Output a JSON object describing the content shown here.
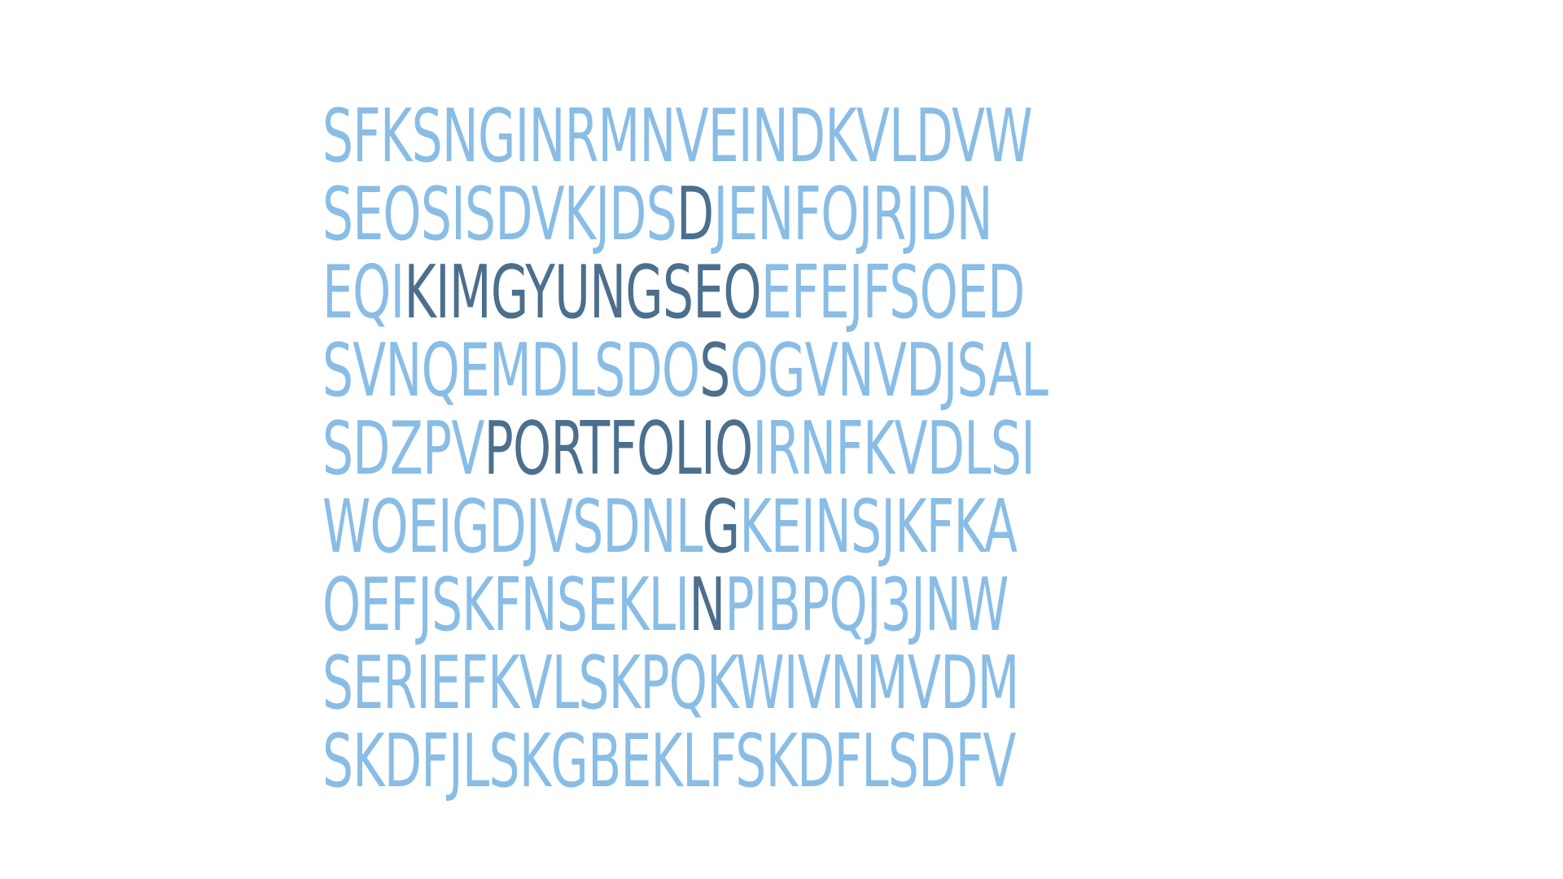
{
  "colors": {
    "background": "#ffffff",
    "dim_letters": "#89bde6",
    "highlight_letters": "#4c6f8d"
  },
  "grid": {
    "rows": [
      {
        "before": "SFKSNGINRMNVEINDKVLDVW",
        "highlight": "",
        "after": ""
      },
      {
        "before": "SEOSISDVKJDS",
        "highlight": "D",
        "after": "JENFOJRJDN"
      },
      {
        "before": "EQI",
        "highlight": "KIMGYUNGSEO",
        "after": "EFEJFSOED"
      },
      {
        "before": "SVNQEMDLSDO",
        "highlight": "S",
        "after": "OGVNVDJSAL"
      },
      {
        "before": "SDZPV",
        "highlight": "PORTFOLIO",
        "after": "IRNFKVDLSI"
      },
      {
        "before": "WOEIGDJVSDNL",
        "highlight": "G",
        "after": "KEINSJKFKA"
      },
      {
        "before": "OEFJSKFNSEKLI",
        "highlight": "N",
        "after": "PIBPQJ3JNW"
      },
      {
        "before": "SERIEFKVLSKPQKWIVNMVDM",
        "highlight": "",
        "after": ""
      },
      {
        "before": "SKDFJLSKGBEKLFSKDFLSDFV",
        "highlight": "",
        "after": ""
      }
    ]
  }
}
